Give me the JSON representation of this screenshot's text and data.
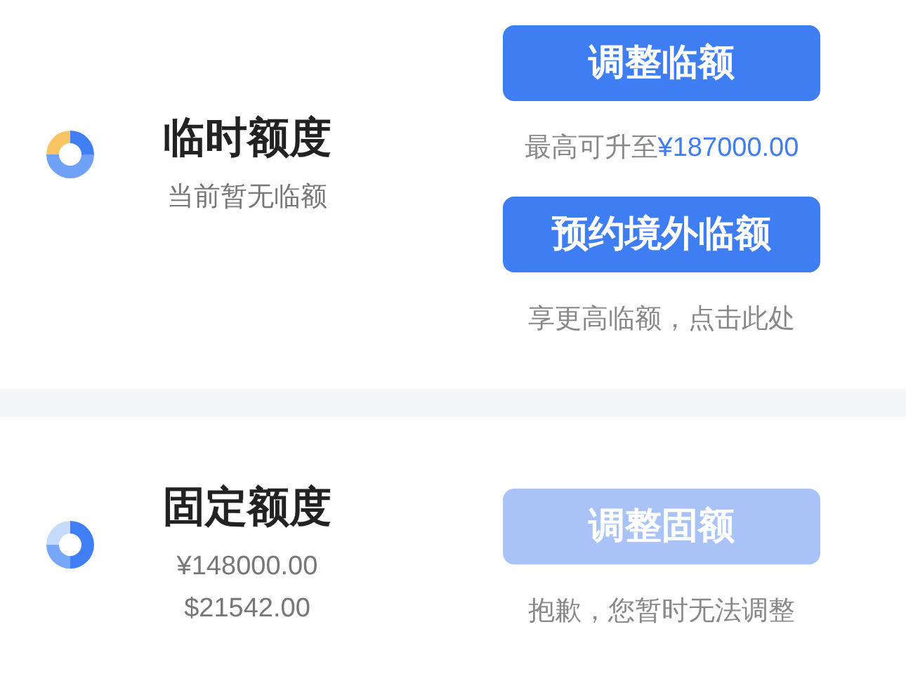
{
  "sections": [
    {
      "kind": "temporary",
      "title": "临时额度",
      "details": [
        "当前暂无临额"
      ],
      "actions": [
        {
          "button": {
            "label": "调整临额",
            "disabled": false
          },
          "note": {
            "text": "最高可升至",
            "highlight": "¥187000.00"
          }
        },
        {
          "button": {
            "label": "预约境外临额",
            "disabled": false
          },
          "note": {
            "text": "享更高临额，点击此处"
          }
        }
      ]
    },
    {
      "kind": "fixed",
      "title": "固定额度",
      "details": [
        "¥148000.00",
        "$21542.00"
      ],
      "actions": [
        {
          "button": {
            "label": "调整固额",
            "disabled": true
          },
          "note": {
            "text": "抱歉，您暂时无法调整"
          }
        }
      ]
    }
  ]
}
